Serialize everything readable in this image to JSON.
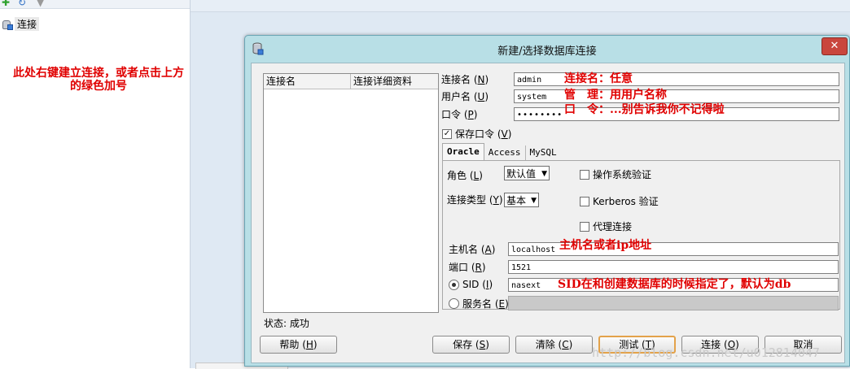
{
  "left_panel": {
    "tree_item_label": "连接",
    "annotation": "此处右键建立连接，或者点击上方的绿色加号"
  },
  "dialog": {
    "title": "新建/选择数据库连接",
    "close_glyph": "✕",
    "list": {
      "headers": [
        "连接名",
        "连接详细资料"
      ]
    },
    "status": "状态: 成功",
    "fields": {
      "conn_name": {
        "label": "连接名",
        "mnemonic": "N",
        "value": "admin",
        "note": "连接名：任意"
      },
      "username": {
        "label": "用户名",
        "mnemonic": "U",
        "value": "system",
        "note": "管　理：用用户名称"
      },
      "password": {
        "label": "口令",
        "mnemonic": "P",
        "value": "••••••••",
        "note": "口　令：...别告诉我你不记得啦"
      },
      "save_password": {
        "label": "保存口令",
        "mnemonic": "V",
        "checked": true
      }
    },
    "tabs": [
      "Oracle",
      "Access",
      "MySQL"
    ],
    "oracle": {
      "role": {
        "label": "角色",
        "mnemonic": "L",
        "value": "默认值"
      },
      "conn_type": {
        "label": "连接类型",
        "mnemonic": "Y",
        "value": "基本"
      },
      "os_auth": {
        "label": "操作系统验证",
        "checked": false
      },
      "kerberos": {
        "label": "Kerberos 验证",
        "checked": false
      },
      "proxy": {
        "label": "代理连接",
        "checked": false
      },
      "host": {
        "label": "主机名",
        "mnemonic": "A",
        "value": "localhost",
        "note": "主机名或者ip地址"
      },
      "port": {
        "label": "端口",
        "mnemonic": "R",
        "value": "1521"
      },
      "sid": {
        "label": "SID",
        "mnemonic": "I",
        "value": "nasext",
        "selected": true,
        "note": "SID在和创建数据库的时候指定了，默认为db"
      },
      "service": {
        "label": "服务名",
        "mnemonic": "E",
        "value": "",
        "selected": false
      }
    },
    "buttons": [
      {
        "label": "帮助",
        "mnemonic": "H"
      },
      {
        "label": "保存",
        "mnemonic": "S"
      },
      {
        "label": "清除",
        "mnemonic": "C"
      },
      {
        "label": "测试",
        "mnemonic": "T"
      },
      {
        "label": "连接",
        "mnemonic": "O"
      },
      {
        "label": "取消",
        "mnemonic": ""
      }
    ]
  },
  "watermark": "http://blog.csdn.net/u012814047",
  "colors": {
    "annotation_red": "#e00000",
    "dialog_frame": "#b8dfe6",
    "close_red": "#c9463d",
    "focus_orange": "#e3a24a"
  }
}
